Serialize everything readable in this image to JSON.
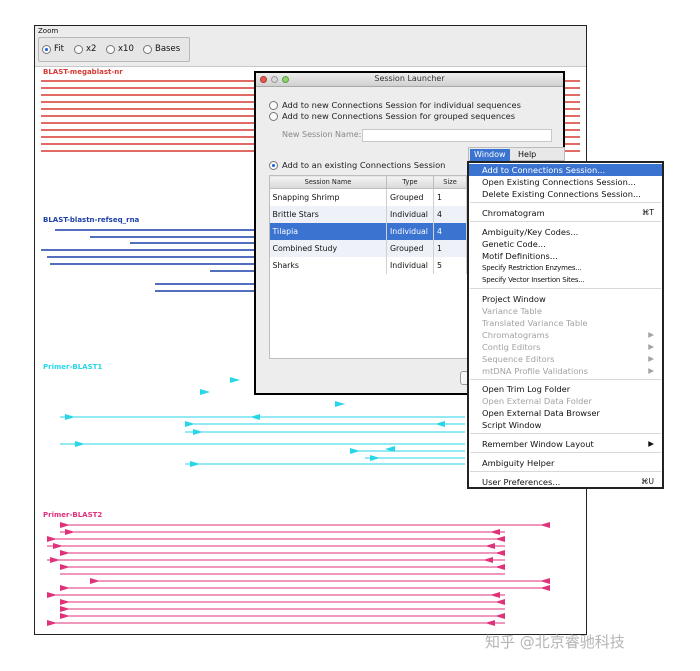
{
  "zoom": {
    "label": "Zoom",
    "options": [
      {
        "label": "Fit",
        "selected": true
      },
      {
        "label": "x2",
        "selected": false
      },
      {
        "label": "x10",
        "selected": false
      },
      {
        "label": "Bases",
        "selected": false
      }
    ]
  },
  "tracks": [
    {
      "label": "BLAST-megablast-nr",
      "color": "#d63a32"
    },
    {
      "label": "BLAST-blastn-refseq_rna",
      "color": "#1c3fa8"
    },
    {
      "label": "Primer-BLAST1",
      "color": "#27d6e8"
    },
    {
      "label": "Primer-BLAST2",
      "color": "#e0327a"
    }
  ],
  "launcher": {
    "title": "Session Launcher",
    "option_individual": "Add to new Connections Session for individual sequences",
    "option_grouped": "Add to new Connections Session for grouped sequences",
    "name_label": "New Session Name:",
    "name_value": "",
    "option_existing": "Add to an existing Connections Session",
    "columns": [
      "Session Name",
      "Type",
      "Size"
    ],
    "rows": [
      {
        "name": "Snapping Shrimp",
        "type": "Grouped",
        "size": "1"
      },
      {
        "name": "Brittle Stars",
        "type": "Individual",
        "size": "4"
      },
      {
        "name": "Tilapia",
        "type": "Individual",
        "size": "4"
      },
      {
        "name": "Combined Study",
        "type": "Grouped",
        "size": "1"
      },
      {
        "name": "Sharks",
        "type": "Individual",
        "size": "5"
      }
    ]
  },
  "menubar": {
    "window": "Window",
    "help": "Help"
  },
  "menu": {
    "items": [
      {
        "label": "Add to Connections Session...",
        "highlighted": true
      },
      {
        "label": "Open Existing Connections Session..."
      },
      {
        "label": "Delete Existing Connections Session..."
      },
      {
        "label": "Chromatogram",
        "shortcut": "⌘T"
      },
      {
        "label": "Ambiguity/Key Codes..."
      },
      {
        "label": "Genetic Code..."
      },
      {
        "label": "Motif Definitions..."
      },
      {
        "label": "Specify Restriction Enzymes..."
      },
      {
        "label": "Specify Vector Insertion Sites..."
      },
      {
        "label": "Project Window"
      },
      {
        "label": "Variance Table",
        "disabled": true
      },
      {
        "label": "Translated Variance Table",
        "disabled": true
      },
      {
        "label": "Chromatograms",
        "disabled": true,
        "submenu": "▶"
      },
      {
        "label": "Contig Editors",
        "disabled": true,
        "submenu": "▶"
      },
      {
        "label": "Sequence Editors",
        "disabled": true,
        "submenu": "▶"
      },
      {
        "label": "mtDNA Profile Validations",
        "disabled": true,
        "submenu": "▶"
      },
      {
        "label": "Open Trim Log Folder"
      },
      {
        "label": "Open External Data Folder",
        "disabled": true
      },
      {
        "label": "Open External Data Browser"
      },
      {
        "label": "Script Window"
      },
      {
        "label": "Remember Window Layout",
        "submenu": "▶"
      },
      {
        "label": "Ambiguity Helper"
      },
      {
        "label": "User Preferences...",
        "shortcut": "⌘U"
      }
    ]
  },
  "watermark": "知乎 @北京睿驰科技"
}
